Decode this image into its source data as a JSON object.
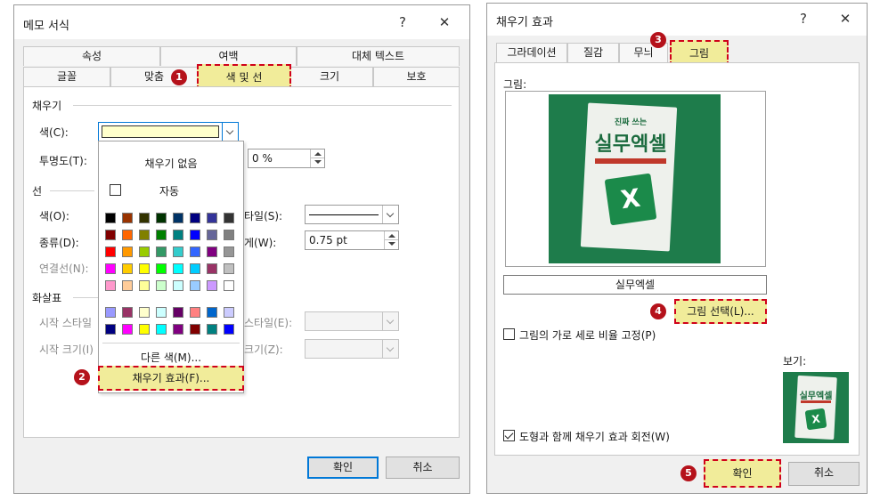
{
  "left": {
    "title": "메모 서식",
    "help": "?",
    "close": "✕",
    "tabs_top": [
      "속성",
      "여백",
      "대체 텍스트"
    ],
    "tabs_bottom": [
      "글꼴",
      "맞춤",
      "색 및 선",
      "크기",
      "보호"
    ],
    "fill_section": "채우기",
    "color_label": "색(C):",
    "transparency_label": "투명도(T):",
    "transparency_value": "0 %",
    "line_section": "선",
    "line_color_label": "색(O):",
    "line_type_label": "종류(D):",
    "connector_label": "연결선(N):",
    "style_label": "타일(S):",
    "weight_label": "게(W):",
    "weight_value": "0.75 pt",
    "arrow_section": "화살표",
    "start_style_label": "시작 스타일",
    "start_size_label": "시작 크기(I)",
    "end_style_label": "스타일(E):",
    "end_size_label": "크기(Z):",
    "ok": "확인",
    "cancel": "취소",
    "dropdown": {
      "no_fill": "채우기 없음",
      "automatic": "자동",
      "more_colors": "다른 색(M)...",
      "fill_effects": "채우기 효과(F)..."
    },
    "current_fill_color": "#ffffcc"
  },
  "right": {
    "title": "채우기 효과",
    "help": "?",
    "close": "✕",
    "tabs": [
      "그라데이션",
      "질감",
      "무늬",
      "그림"
    ],
    "picture_label": "그림:",
    "picture_name": "실무엑셀",
    "select_picture": "그림 선택(L)...",
    "lock_ratio": "그림의 가로 세로 비율 고정(P)",
    "preview_label": "보기:",
    "rotate_with_shape": "도형과 함께 채우기 효과 회전(W)",
    "ok": "확인",
    "cancel": "취소",
    "book": {
      "small": "진짜 쓰는",
      "title": "실무엑셀",
      "logo": "X"
    }
  },
  "badges": [
    "1",
    "2",
    "3",
    "4",
    "5"
  ],
  "colors": {
    "highlight_fill": "#f1ec9a",
    "highlight_border": "#d0021b",
    "badge": "#b5121b",
    "book_green": "#1e7c4b"
  },
  "palette": [
    [
      "#000000",
      "#993300",
      "#333300",
      "#003300",
      "#003366",
      "#000080",
      "#333399",
      "#333333"
    ],
    [
      "#800000",
      "#ff6600",
      "#808000",
      "#008000",
      "#008080",
      "#0000ff",
      "#666699",
      "#808080"
    ],
    [
      "#ff0000",
      "#ff9900",
      "#99cc00",
      "#339966",
      "#33cccc",
      "#3366ff",
      "#800080",
      "#969696"
    ],
    [
      "#ff00ff",
      "#ffcc00",
      "#ffff00",
      "#00ff00",
      "#00ffff",
      "#00ccff",
      "#993366",
      "#c0c0c0"
    ],
    [
      "#ff99cc",
      "#ffcc99",
      "#ffff99",
      "#ccffcc",
      "#ccffff",
      "#99ccff",
      "#cc99ff",
      "#ffffff"
    ],
    [
      "#9999ff",
      "#993366",
      "#ffffcc",
      "#ccffff",
      "#660066",
      "#ff8080",
      "#0066cc",
      "#ccccff"
    ],
    [
      "#000080",
      "#ff00ff",
      "#ffff00",
      "#00ffff",
      "#800080",
      "#800000",
      "#008080",
      "#0000ff"
    ]
  ]
}
